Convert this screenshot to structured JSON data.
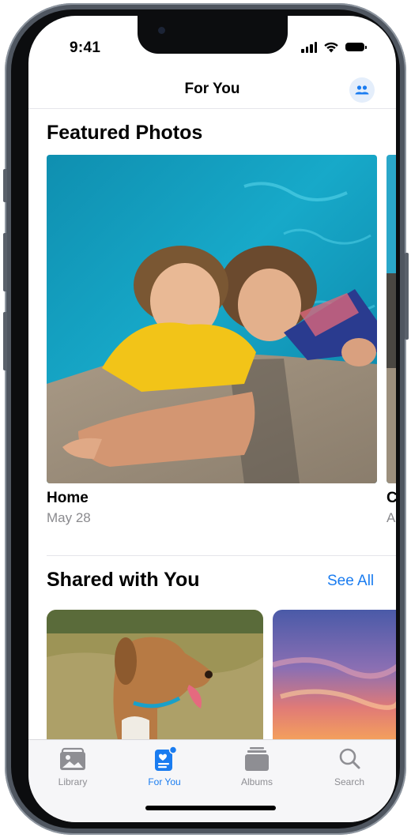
{
  "status_bar": {
    "time": "9:41"
  },
  "nav": {
    "title": "For You",
    "right_icon": "people-icon"
  },
  "featured": {
    "section_title": "Featured Photos",
    "items": [
      {
        "title": "Home",
        "date": "May 28"
      },
      {
        "title": "C",
        "date": "A"
      }
    ]
  },
  "shared": {
    "section_title": "Shared with You",
    "see_all_label": "See All"
  },
  "tabs": [
    {
      "label": "Library",
      "icon": "photo-library-icon",
      "active": false
    },
    {
      "label": "For You",
      "icon": "for-you-icon",
      "active": true
    },
    {
      "label": "Albums",
      "icon": "albums-stack-icon",
      "active": false
    },
    {
      "label": "Search",
      "icon": "search-icon",
      "active": false
    }
  ],
  "colors": {
    "accent": "#1a7cf0",
    "inactive_tab": "#8e8e93",
    "subtitle": "#8a8a8e",
    "frame": "#4f5660"
  }
}
